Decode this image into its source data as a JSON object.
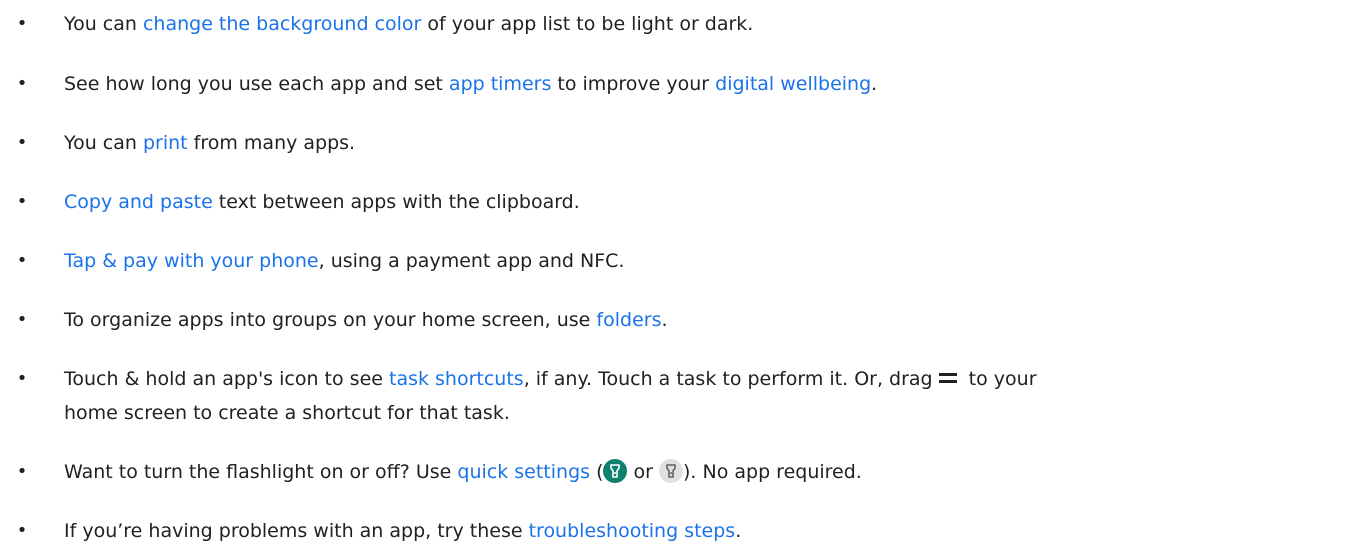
{
  "tips": [
    {
      "pre": "You can ",
      "link": "change the background color",
      "post": " of your app list to be light or dark."
    },
    {
      "pre": "See how long you use each app and set ",
      "link1": "app timers",
      "mid": " to improve your ",
      "link2": "digital wellbeing",
      "post": "."
    },
    {
      "pre": "You can ",
      "link": "print",
      "post": " from many apps."
    },
    {
      "link": "Copy and paste",
      "post": " text between apps with the clipboard."
    },
    {
      "link": "Tap & pay with your phone",
      "post": ", using a payment app and NFC."
    },
    {
      "pre": "To organize apps into groups on your home screen, use ",
      "link": "folders",
      "post": "."
    },
    {
      "pre": "Touch & hold an app's icon to see ",
      "link": "task shortcuts",
      "mid": ", if any. Touch a task to perform it. Or, drag",
      "post_line1": " to your",
      "post_line2": "home screen to create a shortcut for that task."
    },
    {
      "pre": "Want to turn the flashlight on or off? Use ",
      "link": "quick settings",
      "paren_open": " (",
      "or": " or ",
      "post": "). No app required."
    },
    {
      "pre": "If you’re having problems with an app, try these ",
      "link": "troubleshooting steps",
      "post": "."
    }
  ],
  "bullet": "•",
  "icons": {
    "drag_handle": "drag-handle-icon",
    "flashlight_on": "flashlight-on-icon",
    "flashlight_off": "flashlight-off-icon"
  },
  "colors": {
    "text": "#202124",
    "link": "#1a73e8",
    "flash_on": "#0f7f6e",
    "flash_off": "#e0e0e0"
  }
}
